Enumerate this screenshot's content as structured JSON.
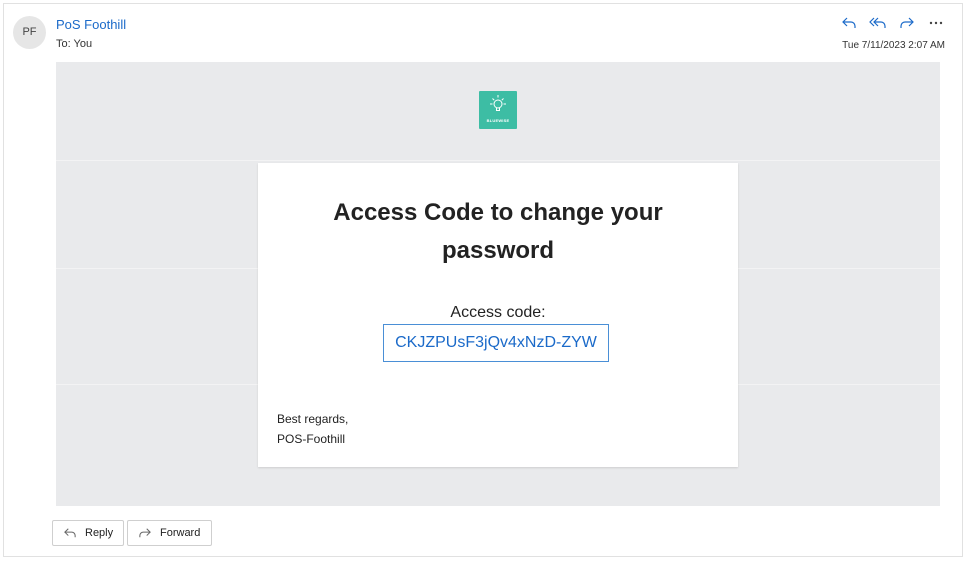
{
  "header": {
    "avatar_initials": "PF",
    "sender_name": "PoS Foothill",
    "to_label": "To:",
    "to_value": "You",
    "date": "Tue 7/11/2023 2:07 AM"
  },
  "header_actions": [
    {
      "name": "reply-icon",
      "icon": "reply"
    },
    {
      "name": "reply-all-icon",
      "icon": "reply-all"
    },
    {
      "name": "forward-icon",
      "icon": "forward"
    },
    {
      "name": "more-options-icon",
      "icon": "ellipsis"
    }
  ],
  "message": {
    "logo_text": "BLUEWISE",
    "logo_color": "#3dbda4",
    "title": "Access Code to change your password",
    "code_label": "Access code:",
    "code_value": "CKJZPUsF3jQv4xNzD-ZYW",
    "regards_line1": "Best regards,",
    "regards_line2": "POS-Foothill"
  },
  "footer_buttons": {
    "reply_label": "Reply",
    "forward_label": "Forward"
  },
  "colors": {
    "link_blue": "#1b6ac9",
    "body_background": "#e9eaec",
    "code_border": "#4a8fd6"
  }
}
